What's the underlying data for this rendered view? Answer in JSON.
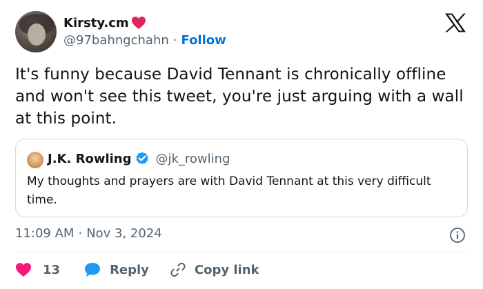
{
  "author": {
    "display_name": "Kirsty.cm",
    "name_emoji_icon": "red-heart-icon",
    "handle": "@97bahngchahn",
    "separator": "·",
    "follow_label": "Follow"
  },
  "platform_icon": "x-logo-icon",
  "tweet": {
    "text": "It's funny because David Tennant is chronically offline and won't see this tweet, you're just arguing with a wall at this point."
  },
  "quoted_tweet": {
    "display_name": "J.K. Rowling",
    "verified_icon": "verified-badge-icon",
    "handle": "@jk_rowling",
    "text": "My thoughts and prayers are with David Tennant at this very difficult time."
  },
  "meta": {
    "time": "11:09 AM",
    "separator": "·",
    "date": "Nov 3, 2024"
  },
  "actions": {
    "like_count": "13",
    "reply_label": "Reply",
    "copy_link_label": "Copy link"
  },
  "colors": {
    "accent": "#0074d4",
    "like": "#f91880",
    "verified": "#1d9bf0",
    "muted_text": "#536471",
    "border": "#cfd9de"
  }
}
